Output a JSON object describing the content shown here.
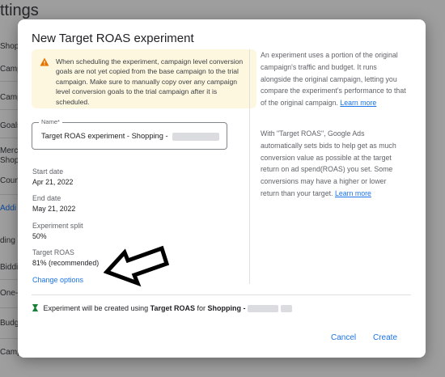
{
  "background": {
    "page_title": "ttings",
    "side_items": [
      {
        "label": "Shoppi",
        "top": 0
      },
      {
        "label": "Camp",
        "top": 0
      },
      {
        "label": "Camp",
        "top": 0
      },
      {
        "label": "Goals",
        "top": 0
      },
      {
        "label": "Merc",
        "top": 0
      },
      {
        "label": "Shop",
        "top": 0
      },
      {
        "label": "Coun",
        "top": 0
      },
      {
        "label": "Addi",
        "top": 0
      },
      {
        "label": "ding",
        "top": 0
      },
      {
        "label": "Biddi",
        "top": 0
      },
      {
        "label": "One-",
        "top": 0
      },
      {
        "label": "Budg",
        "top": 0
      },
      {
        "label": "Camp",
        "top": 0
      }
    ]
  },
  "dialog": {
    "title": "New Target ROAS experiment",
    "warning": "When scheduling the experiment, campaign level conversion goals are not yet copied from the base campaign to the trial campaign. Make sure to manually copy over any campaign level conversion goals to the trial campaign after it is scheduled.",
    "name_field": {
      "label": "Name*",
      "value": "Target ROAS experiment - Shopping -"
    },
    "fields": [
      {
        "label": "Start date",
        "value": "Apr 21, 2022"
      },
      {
        "label": "End date",
        "value": "May 21, 2022"
      },
      {
        "label": "Experiment split",
        "value": "50%"
      },
      {
        "label": "Target ROAS",
        "value": "81% (recommended)"
      }
    ],
    "change_options": "Change options",
    "info": {
      "p1": "An experiment uses a portion of the original campaign's traffic and budget. It runs alongside the original campaign, letting you compare the experiment's performance to that of the original campaign.",
      "p1_link": "Learn more",
      "p2": "With \"Target ROAS\", Google Ads automatically sets bids to help get as much conversion value as possible at the target return on ad spend(ROAS) you set. Some conversions may have a higher or lower return than your target.",
      "p2_link": "Learn more"
    },
    "summary": {
      "prefix": "Experiment will be created using",
      "strategy": "Target ROAS",
      "for": "for",
      "campaign": "Shopping -"
    },
    "buttons": {
      "cancel": "Cancel",
      "create": "Create"
    }
  },
  "colors": {
    "accent": "#1a73e8",
    "warning_bg": "#fef7e0",
    "warning_icon": "#e37400",
    "flask": "#188038"
  },
  "icons": {
    "warning": "warning-icon",
    "summary": "experiment-flask-icon",
    "annotation": "arrow-annotation"
  }
}
